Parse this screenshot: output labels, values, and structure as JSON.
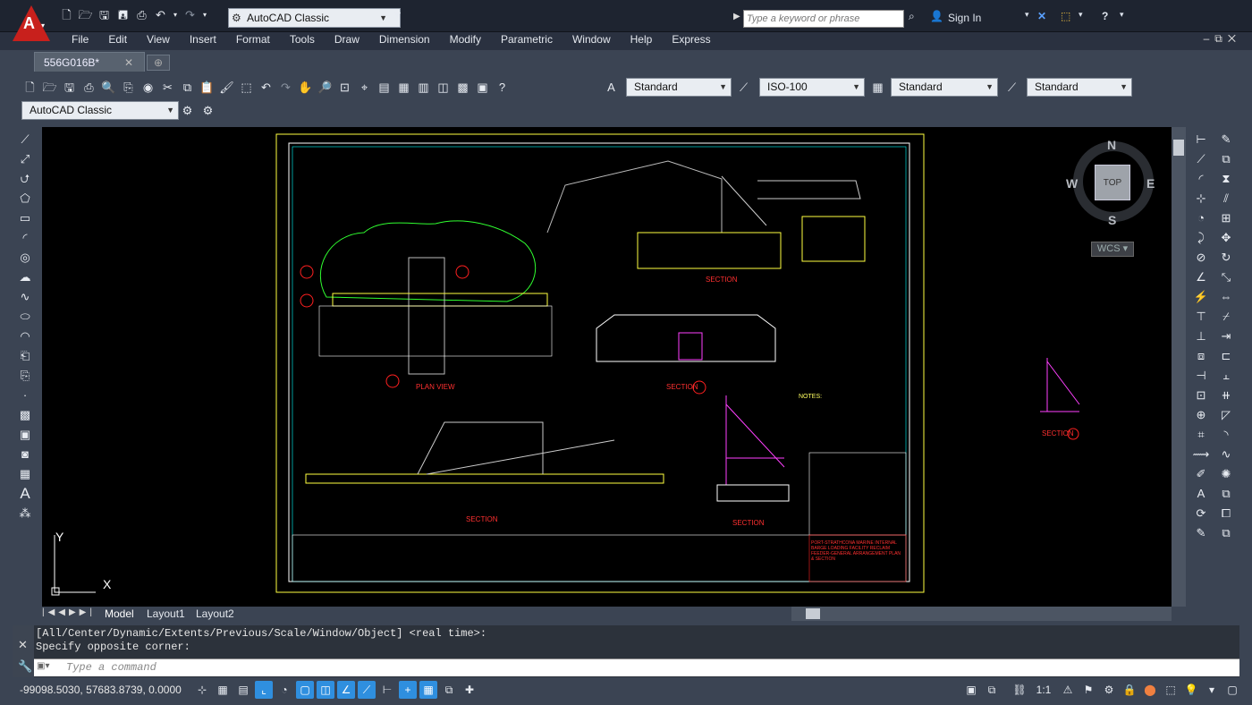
{
  "app": {
    "name": "AutoCAD"
  },
  "quick_access": {
    "workspace": "AutoCAD Classic",
    "icons": [
      "new-icon",
      "open-icon",
      "save-icon",
      "save-as-icon",
      "print-icon",
      "undo-icon",
      "redo-icon"
    ]
  },
  "search": {
    "placeholder": "Type a keyword or phrase"
  },
  "account": {
    "sign_in": "Sign In"
  },
  "menu": [
    "File",
    "Edit",
    "View",
    "Insert",
    "Format",
    "Tools",
    "Draw",
    "Dimension",
    "Modify",
    "Parametric",
    "Window",
    "Help",
    "Express"
  ],
  "document_tab": {
    "name": "556G016B*"
  },
  "styles": {
    "text_style": "Standard",
    "dim_style": "ISO-100",
    "table_style": "Standard",
    "multileader_style": "Standard"
  },
  "workspace_toolbar": {
    "workspace": "AutoCAD Classic"
  },
  "viewcube": {
    "top": "TOP",
    "n": "N",
    "s": "S",
    "e": "E",
    "w": "W",
    "wcs": "WCS"
  },
  "ucs": {
    "x": "X",
    "y": "Y"
  },
  "layout_tabs": [
    "Model",
    "Layout1",
    "Layout2"
  ],
  "command": {
    "history": [
      "[All/Center/Dynamic/Extents/Previous/Scale/Window/Object] <real time>:",
      "Specify opposite corner:"
    ],
    "placeholder": "Type a command"
  },
  "status": {
    "coordinates": "-99098.5030, 57683.8739, 0.0000",
    "annotation_scale": "1:1"
  },
  "drawing": {
    "labels": {
      "plan_view": "PLAN VIEW",
      "section_a": "SECTION",
      "section_b": "SECTION",
      "section_c": "SECTION",
      "section_d": "SECTION",
      "section_e": "SECTION",
      "notes": "NOTES:",
      "title_block": "PORT-STRATHCONA MARINE INTERNAL BARGE LOADING FACILITY RECLAIM FEEDER-GENERAL ARRANGEMENT PLAN & SECTION"
    }
  }
}
